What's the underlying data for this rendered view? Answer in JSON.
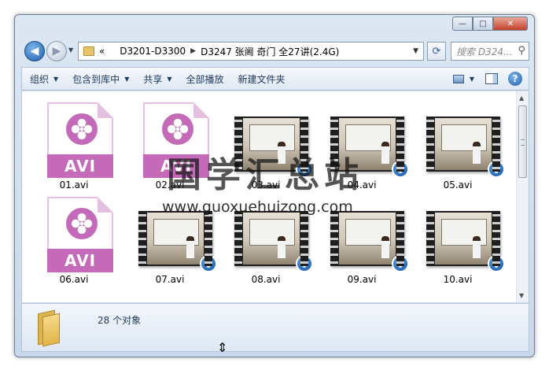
{
  "window": {
    "caption": {
      "minimize": "—",
      "maximize": "□",
      "close": "✕"
    }
  },
  "nav": {
    "back_icon": "arrow-left-icon",
    "forward_icon": "arrow-right-icon",
    "back_glyph": "◀",
    "forward_glyph": "▶",
    "dropdown_glyph": "▼",
    "address": {
      "overflow": "«",
      "crumbs": [
        "D3201-D3300",
        "D3247 张阃 奇门 全27讲(2.4G)"
      ],
      "separator": "▶",
      "dropdown": "▼"
    },
    "refresh_glyph": "⟳",
    "search": {
      "placeholder": "搜索 D324...",
      "icon_glyph": "⚲"
    }
  },
  "toolbar": {
    "items": [
      {
        "label": "组织",
        "dropdown": true
      },
      {
        "label": "包含到库中",
        "dropdown": true
      },
      {
        "label": "共享",
        "dropdown": true
      },
      {
        "label": "全部播放",
        "dropdown": false
      },
      {
        "label": "新建文件夹",
        "dropdown": false
      }
    ],
    "dropdown_glyph": "▼",
    "view_dropdown_glyph": "▼",
    "help_glyph": "?"
  },
  "files": [
    {
      "name": "01.avi",
      "kind": "avi-doc"
    },
    {
      "name": "02.avi",
      "kind": "avi-doc"
    },
    {
      "name": "03.avi",
      "kind": "video"
    },
    {
      "name": "04.avi",
      "kind": "video"
    },
    {
      "name": "05.avi",
      "kind": "video"
    },
    {
      "name": "06.avi",
      "kind": "avi-doc"
    },
    {
      "name": "07.avi",
      "kind": "video"
    },
    {
      "name": "08.avi",
      "kind": "video"
    },
    {
      "name": "09.avi",
      "kind": "video"
    },
    {
      "name": "10.avi",
      "kind": "video"
    },
    {
      "name": "",
      "kind": "video"
    },
    {
      "name": "",
      "kind": "video"
    },
    {
      "name": "",
      "kind": "video"
    },
    {
      "name": "",
      "kind": "video"
    },
    {
      "name": "",
      "kind": "video"
    }
  ],
  "avi_label": "AVI",
  "scrollbar": {
    "up": "▲",
    "down": "▼"
  },
  "details": {
    "count": "28 个对象"
  },
  "cursor_glyph": "⇕",
  "watermark": {
    "title": "国学汇总站",
    "url": "www.guoxuehuizong.com"
  }
}
